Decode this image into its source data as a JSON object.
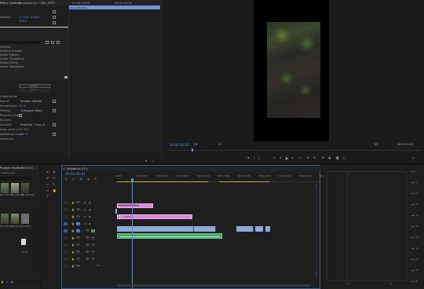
{
  "source_panel": {
    "tab_label": "Effect Controls",
    "tab_separator": "≡",
    "sequence_label": "Sequence 01 • IMG_0799...",
    "ruler_times": [
      "00:00:15:00",
      "00:00:20:00"
    ],
    "clip_label": "IMG_0799.MOV",
    "params": [
      {
        "label": "Position",
        "value_a": "1774.8",
        "value_b": "1008.0"
      },
      {
        "label": "Scale",
        "value_a": "",
        "value_b": ""
      },
      {
        "label": "",
        "value_a": "100.0",
        "value_b": ""
      }
    ]
  },
  "warp_panel": {
    "items": [
      {
        "label": "Position",
        "value": ""
      },
      {
        "label": "Position Presets",
        "value": ""
      },
      {
        "label": "Audio Effects",
        "value": ""
      },
      {
        "label": "Audio Transitions",
        "value": ""
      },
      {
        "label": "Video Effects",
        "value": ""
      },
      {
        "label": "Video Transitions",
        "value": ""
      }
    ],
    "analysis_button": "Analyze",
    "cancel_button": "Cancel",
    "stabilization_header": "Stabilization",
    "settings": [
      {
        "label": "Result",
        "value": "Smooth Motion"
      },
      {
        "label": "Smoothness",
        "value": "50 %"
      },
      {
        "label": "Method",
        "value": "Subspace Warp"
      },
      {
        "label": "Preserve Scale",
        "value": ""
      },
      {
        "label": "Borders",
        "value": ""
      },
      {
        "label": "Framing",
        "value": "Stabilize, Crop, A..."
      },
      {
        "label": "Auto-scale (115.3%)",
        "value": ""
      },
      {
        "label": "Additional Scale",
        "value": "100 %"
      },
      {
        "label": "Advanced",
        "value": ""
      }
    ]
  },
  "program_monitor": {
    "timecode": "00:00:46:42",
    "fit": "Fit",
    "quality": "1/2",
    "duration": "00:07:51:47"
  },
  "project_panel": {
    "tab_label": "Project: Untitled",
    "tab2_label": "Media Br",
    "path": "Untitled.prproj",
    "items": [
      {
        "name": "IMG_0799.MOV",
        "dur": "0:22"
      },
      {
        "name": "IMG_0800.MOV",
        "dur": "0:10"
      },
      {
        "name": "IMG_0801.MOV",
        "dur": "0:14"
      },
      {
        "name": "IMG_0802.MOV",
        "dur": "0:08"
      },
      {
        "name": "Sequence 01",
        "dur": "7:51:47"
      },
      {
        "name": "Soundtrack",
        "dur": "2:12:09"
      }
    ]
  },
  "timeline": {
    "tab_label": "Sequence 01",
    "timecode": "00:00:46:42",
    "ruler": [
      "00:00",
      "00:00:15:00",
      "00:00:30:00",
      "00:00:45:00",
      "00:01:00:00",
      "00:01:15:00",
      "00:01:30:00",
      "00:01:45:00",
      "00:02:00:00",
      "00:02:15:00",
      "00:02:30:00"
    ],
    "tracks": [
      {
        "name": "V4"
      },
      {
        "name": "V3"
      },
      {
        "name": "V2"
      },
      {
        "name": "V1"
      },
      {
        "name": "A1"
      },
      {
        "name": "A2"
      },
      {
        "name": "A3"
      },
      {
        "name": "A4"
      },
      {
        "name": "A5"
      },
      {
        "name": "Mix"
      }
    ],
    "track_btn_v": "fx",
    "track_btn_a": "M",
    "track_btn_s": "S",
    "mix_value": "0.0",
    "graphic_label": "Graphic"
  },
  "audio_meter": {
    "labels": [
      "0",
      "-6",
      "-12",
      "-18",
      "-24",
      "-30",
      "-36",
      "-42",
      "-48",
      "-54",
      "dB"
    ],
    "bottom": [
      "S",
      "S"
    ]
  },
  "colors": {
    "accent": "#4f8fe0",
    "video_clip": "#8fa8d6",
    "graphic_clip": "#d98ad9",
    "audio_clip": "#46a76a"
  }
}
